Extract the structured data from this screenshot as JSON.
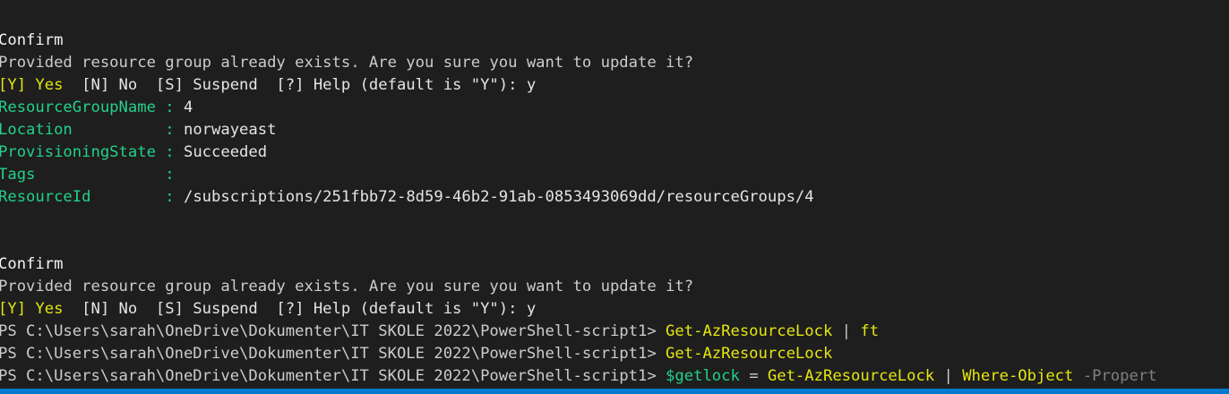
{
  "block1": {
    "confirm_title": "Confirm",
    "question": "Provided resource group already exists. Are you sure you want to update it?",
    "yes_option": "[Y] Yes",
    "other_options": "  [N] No  [S] Suspend  [?] Help (default is \"Y\"): y"
  },
  "properties": [
    {
      "key": "ResourceGroupName ",
      "sep": ": ",
      "value": "4"
    },
    {
      "key": "Location          ",
      "sep": ": ",
      "value": "norwayeast"
    },
    {
      "key": "ProvisioningState ",
      "sep": ": ",
      "value": "Succeeded"
    },
    {
      "key": "Tags              ",
      "sep": ": ",
      "value": ""
    },
    {
      "key": "ResourceId        ",
      "sep": ": ",
      "value": "/subscriptions/251fbb72-8d59-46b2-91ab-0853493069dd/resourceGroups/4"
    }
  ],
  "block2": {
    "confirm_title": "Confirm",
    "question": "Provided resource group already exists. Are you sure you want to update it?",
    "yes_option": "[Y] Yes",
    "other_options": "  [N] No  [S] Suspend  [?] Help (default is \"Y\"): y"
  },
  "prompts": [
    {
      "prompt": "PS C:\\Users\\sarah\\OneDrive\\Dokumenter\\IT SKOLE 2022\\PowerShell-script1> ",
      "cmd": "Get-AzResourceLock",
      "rest": " | ",
      "cmd2": "ft"
    },
    {
      "prompt": "PS C:\\Users\\sarah\\OneDrive\\Dokumenter\\IT SKOLE 2022\\PowerShell-script1> ",
      "cmd": "Get-AzResourceLock"
    },
    {
      "prompt": "PS C:\\Users\\sarah\\OneDrive\\Dokumenter\\IT SKOLE 2022\\PowerShell-script1> ",
      "var": "$getlock",
      "assign": " = ",
      "cmd": "Get-AzResourceLock",
      "pipe": " | ",
      "cmd2": "Where-Object",
      "param": " -Propert"
    }
  ],
  "colors": {
    "background": "#1e1e1e",
    "text": "#cccccc",
    "yellow": "#e5e510",
    "green": "#23d18b",
    "status_bar": "#007acc"
  }
}
